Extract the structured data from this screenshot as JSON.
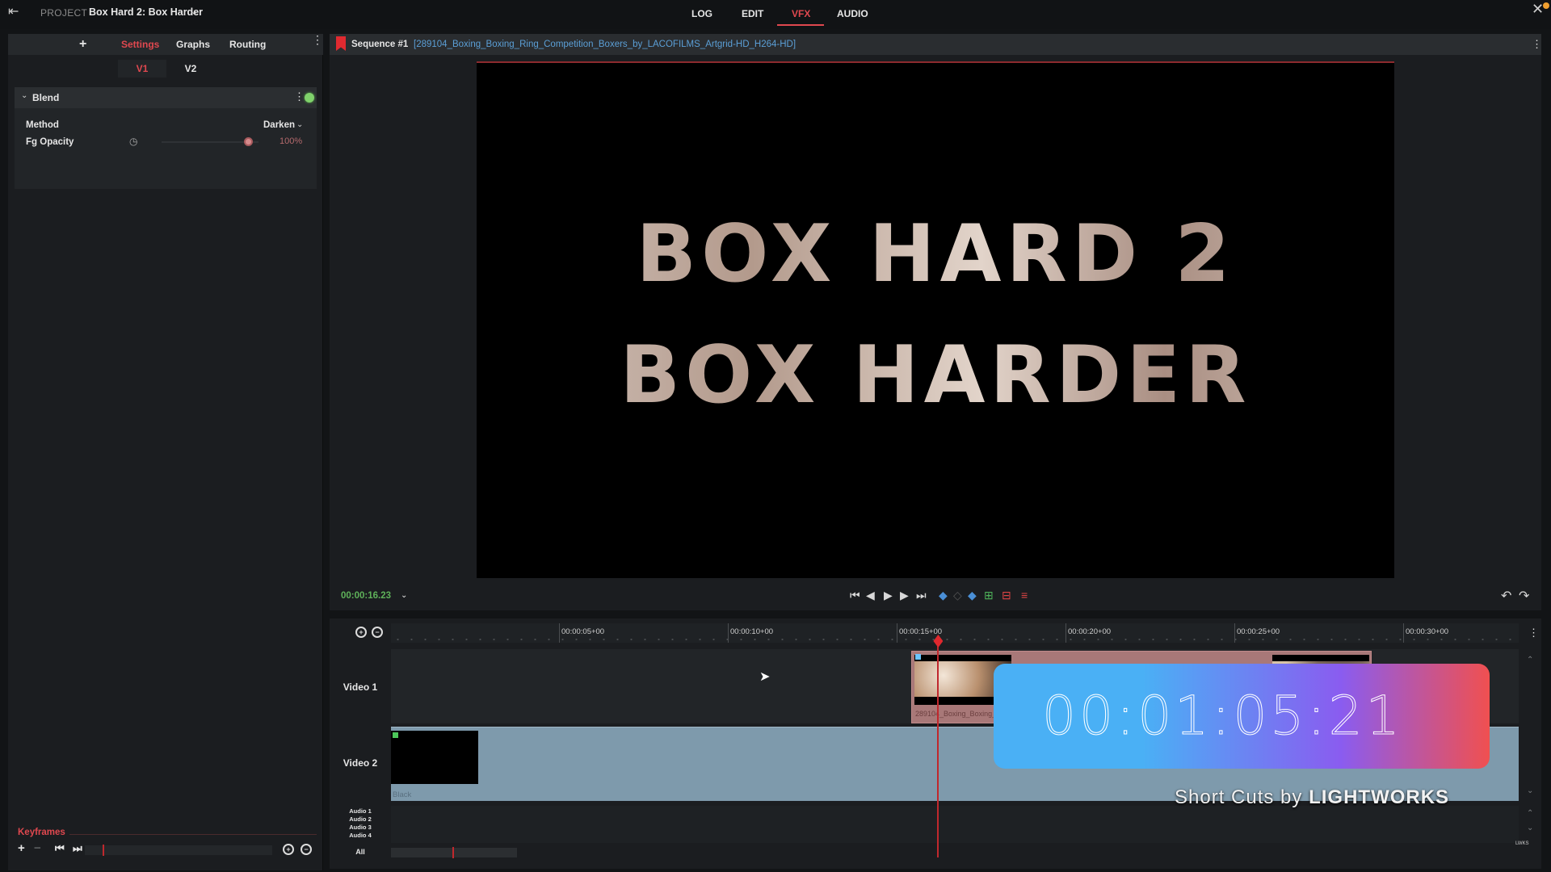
{
  "topbar": {
    "project_label": "PROJECT",
    "project_name": "Box Hard 2: Box Harder",
    "modes": [
      {
        "label": "LOG",
        "active": false
      },
      {
        "label": "EDIT",
        "active": false
      },
      {
        "label": "VFX",
        "active": true
      },
      {
        "label": "AUDIO",
        "active": false
      }
    ],
    "accent_color": "#e0484f"
  },
  "left_panel": {
    "tabs": [
      {
        "label": "Settings",
        "active": true
      },
      {
        "label": "Graphs",
        "active": false
      },
      {
        "label": "Routing",
        "active": false
      }
    ],
    "add_icon": "plus-icon",
    "track_tabs": [
      {
        "label": "V1",
        "active": true
      },
      {
        "label": "V2",
        "active": false
      }
    ],
    "effect": {
      "title": "Blend",
      "enabled": true,
      "params": {
        "method_label": "Method",
        "method_value": "Darken",
        "opacity_label": "Fg Opacity",
        "opacity_value": "100%",
        "opacity_fraction": 1.0
      }
    },
    "keyframes": {
      "label": "Keyframes"
    }
  },
  "viewer": {
    "sequence_name": "Sequence #1",
    "source_file": "[289104_Boxing_Boxing_Ring_Competition_Boxers_by_LACOFILMS_Artgrid-HD_H264-HD]",
    "title_line1": "BOX HARD 2",
    "title_line2": "BOX HARDER",
    "timecode": "00:00:16.23"
  },
  "timeline": {
    "ruler_ticks": [
      "00:00:05+00",
      "00:00:10+00",
      "00:00:15+00",
      "00:00:20+00",
      "00:00:25+00",
      "00:00:30+00"
    ],
    "playhead_seconds": 16.23,
    "tracks": {
      "video1": "Video 1",
      "video2": "Video 2",
      "audio": [
        "Audio 1",
        "Audio 2",
        "Audio 3",
        "Audio 4"
      ],
      "all": "All"
    },
    "clip_v1_name": "289104_Boxing_Boxing_Ring_Competition_Boxers_by_LACOFILMS_Artgrid-HD_H264-HD",
    "clip_v2_name": "Black"
  },
  "overlay": {
    "timecode": "00:01:05:21",
    "branding_prefix": "Short Cuts by",
    "branding_brand": "LIGHTWORKS",
    "watermark": "LWKS"
  }
}
